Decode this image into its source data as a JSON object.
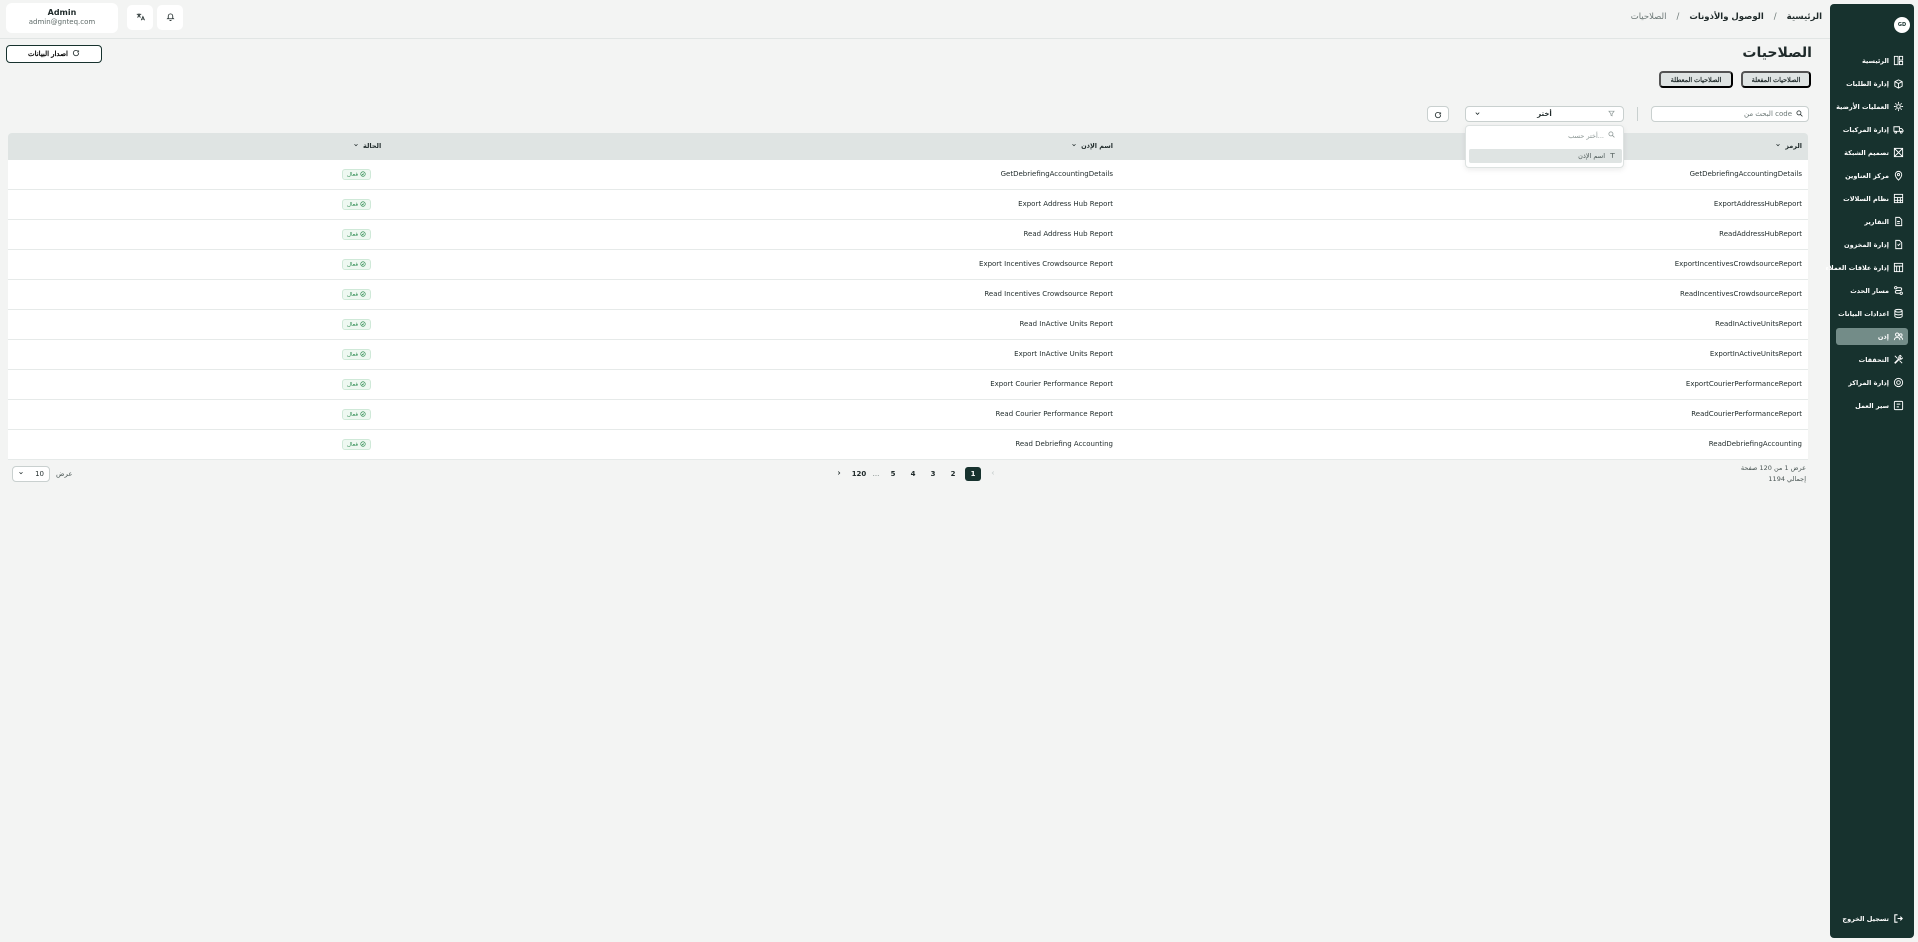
{
  "sidebar": {
    "avatar_initials": "GD",
    "items": [
      {
        "label": "الرئيسية",
        "icon": "dashboard-icon",
        "active": false
      },
      {
        "label": "إدارة الطلبات",
        "icon": "package-icon",
        "active": false
      },
      {
        "label": "العمليات الأرضية",
        "icon": "gear-icon",
        "active": false
      },
      {
        "label": "إدارة المركبات",
        "icon": "truck-icon",
        "active": false
      },
      {
        "label": "تصميم الشبكة",
        "icon": "network-icon",
        "active": false
      },
      {
        "label": "مركز العناوين",
        "icon": "map-pin-icon",
        "active": false
      },
      {
        "label": "نظام السلالات",
        "icon": "grid-icon",
        "active": false
      },
      {
        "label": "التقارير",
        "icon": "report-icon",
        "active": false
      },
      {
        "label": "إدارة المخزون",
        "icon": "box-icon",
        "active": false
      },
      {
        "label": "إدارة علاقات العملاء",
        "icon": "crm-icon",
        "active": false
      },
      {
        "label": "مسار الحدث",
        "icon": "route-icon",
        "active": false
      },
      {
        "label": "اعدادات البيانات",
        "icon": "database-icon",
        "active": false
      },
      {
        "label": "إذن",
        "icon": "users-icon",
        "active": true
      },
      {
        "label": "التحققات",
        "icon": "tools-icon",
        "active": false
      },
      {
        "label": "إدارة المراكز",
        "icon": "location-icon",
        "active": false
      },
      {
        "label": "سير العمل",
        "icon": "workflow-icon",
        "active": false
      }
    ],
    "logout_label": "تسجيل الخروج"
  },
  "header": {
    "breadcrumb": [
      "الرئيسية",
      "الوصول والأذونات",
      "الصلاحيات"
    ],
    "user_name": "Admin",
    "user_email": "admin@gnteq.com"
  },
  "page": {
    "title": "الصلاحيات",
    "export_label": "اصدار البيانات",
    "tabs": [
      "الصلاحيات المفعلة",
      "الصلاحيات المعطلة"
    ]
  },
  "search": {
    "placeholder": "البحث من code",
    "value": ""
  },
  "filter": {
    "selected": "أختر",
    "search_placeholder": "أختر حسب...",
    "options": [
      "اسم الإذن"
    ]
  },
  "table": {
    "columns": [
      "الرمز",
      "اسم الإذن",
      "الحالة"
    ],
    "rows": [
      {
        "code": "GetDebriefingAccountingDetails",
        "name": "GetDebriefingAccountingDetails",
        "status": "فعال"
      },
      {
        "code": "ExportAddressHubReport",
        "name": "Export Address Hub Report",
        "status": "فعال"
      },
      {
        "code": "ReadAddressHubReport",
        "name": "Read Address Hub Report",
        "status": "فعال"
      },
      {
        "code": "ExportIncentivesCrowdsourceReport",
        "name": "Export Incentives Crowdsource Report",
        "status": "فعال"
      },
      {
        "code": "ReadIncentivesCrowdsourceReport",
        "name": "Read Incentives Crowdsource Report",
        "status": "فعال"
      },
      {
        "code": "ReadInActiveUnitsReport",
        "name": "Read InActive Units Report",
        "status": "فعال"
      },
      {
        "code": "ExportInActiveUnitsReport",
        "name": "Export InActive Units Report",
        "status": "فعال"
      },
      {
        "code": "ExportCourierPerformanceReport",
        "name": "Export Courier Performance Report",
        "status": "فعال"
      },
      {
        "code": "ReadCourierPerformanceReport",
        "name": "Read Courier Performance Report",
        "status": "فعال"
      },
      {
        "code": "ReadDebriefingAccounting",
        "name": "Read Debriefing Accounting",
        "status": "فعال"
      }
    ]
  },
  "pagination": {
    "summary_line1": "عرض 1 من 120 صفحة",
    "summary_line2": "إجمالي 1194",
    "pages": [
      "1",
      "2",
      "3",
      "4",
      "5",
      "...",
      "120"
    ],
    "current_page": "1",
    "page_size_label": "عرض",
    "page_size": "10"
  },
  "colors": {
    "sidebar_bg": "#17322e",
    "active_item_bg": "#738c88",
    "status_green": "#2b8a4e",
    "header_row_bg": "#dfe4e3"
  }
}
